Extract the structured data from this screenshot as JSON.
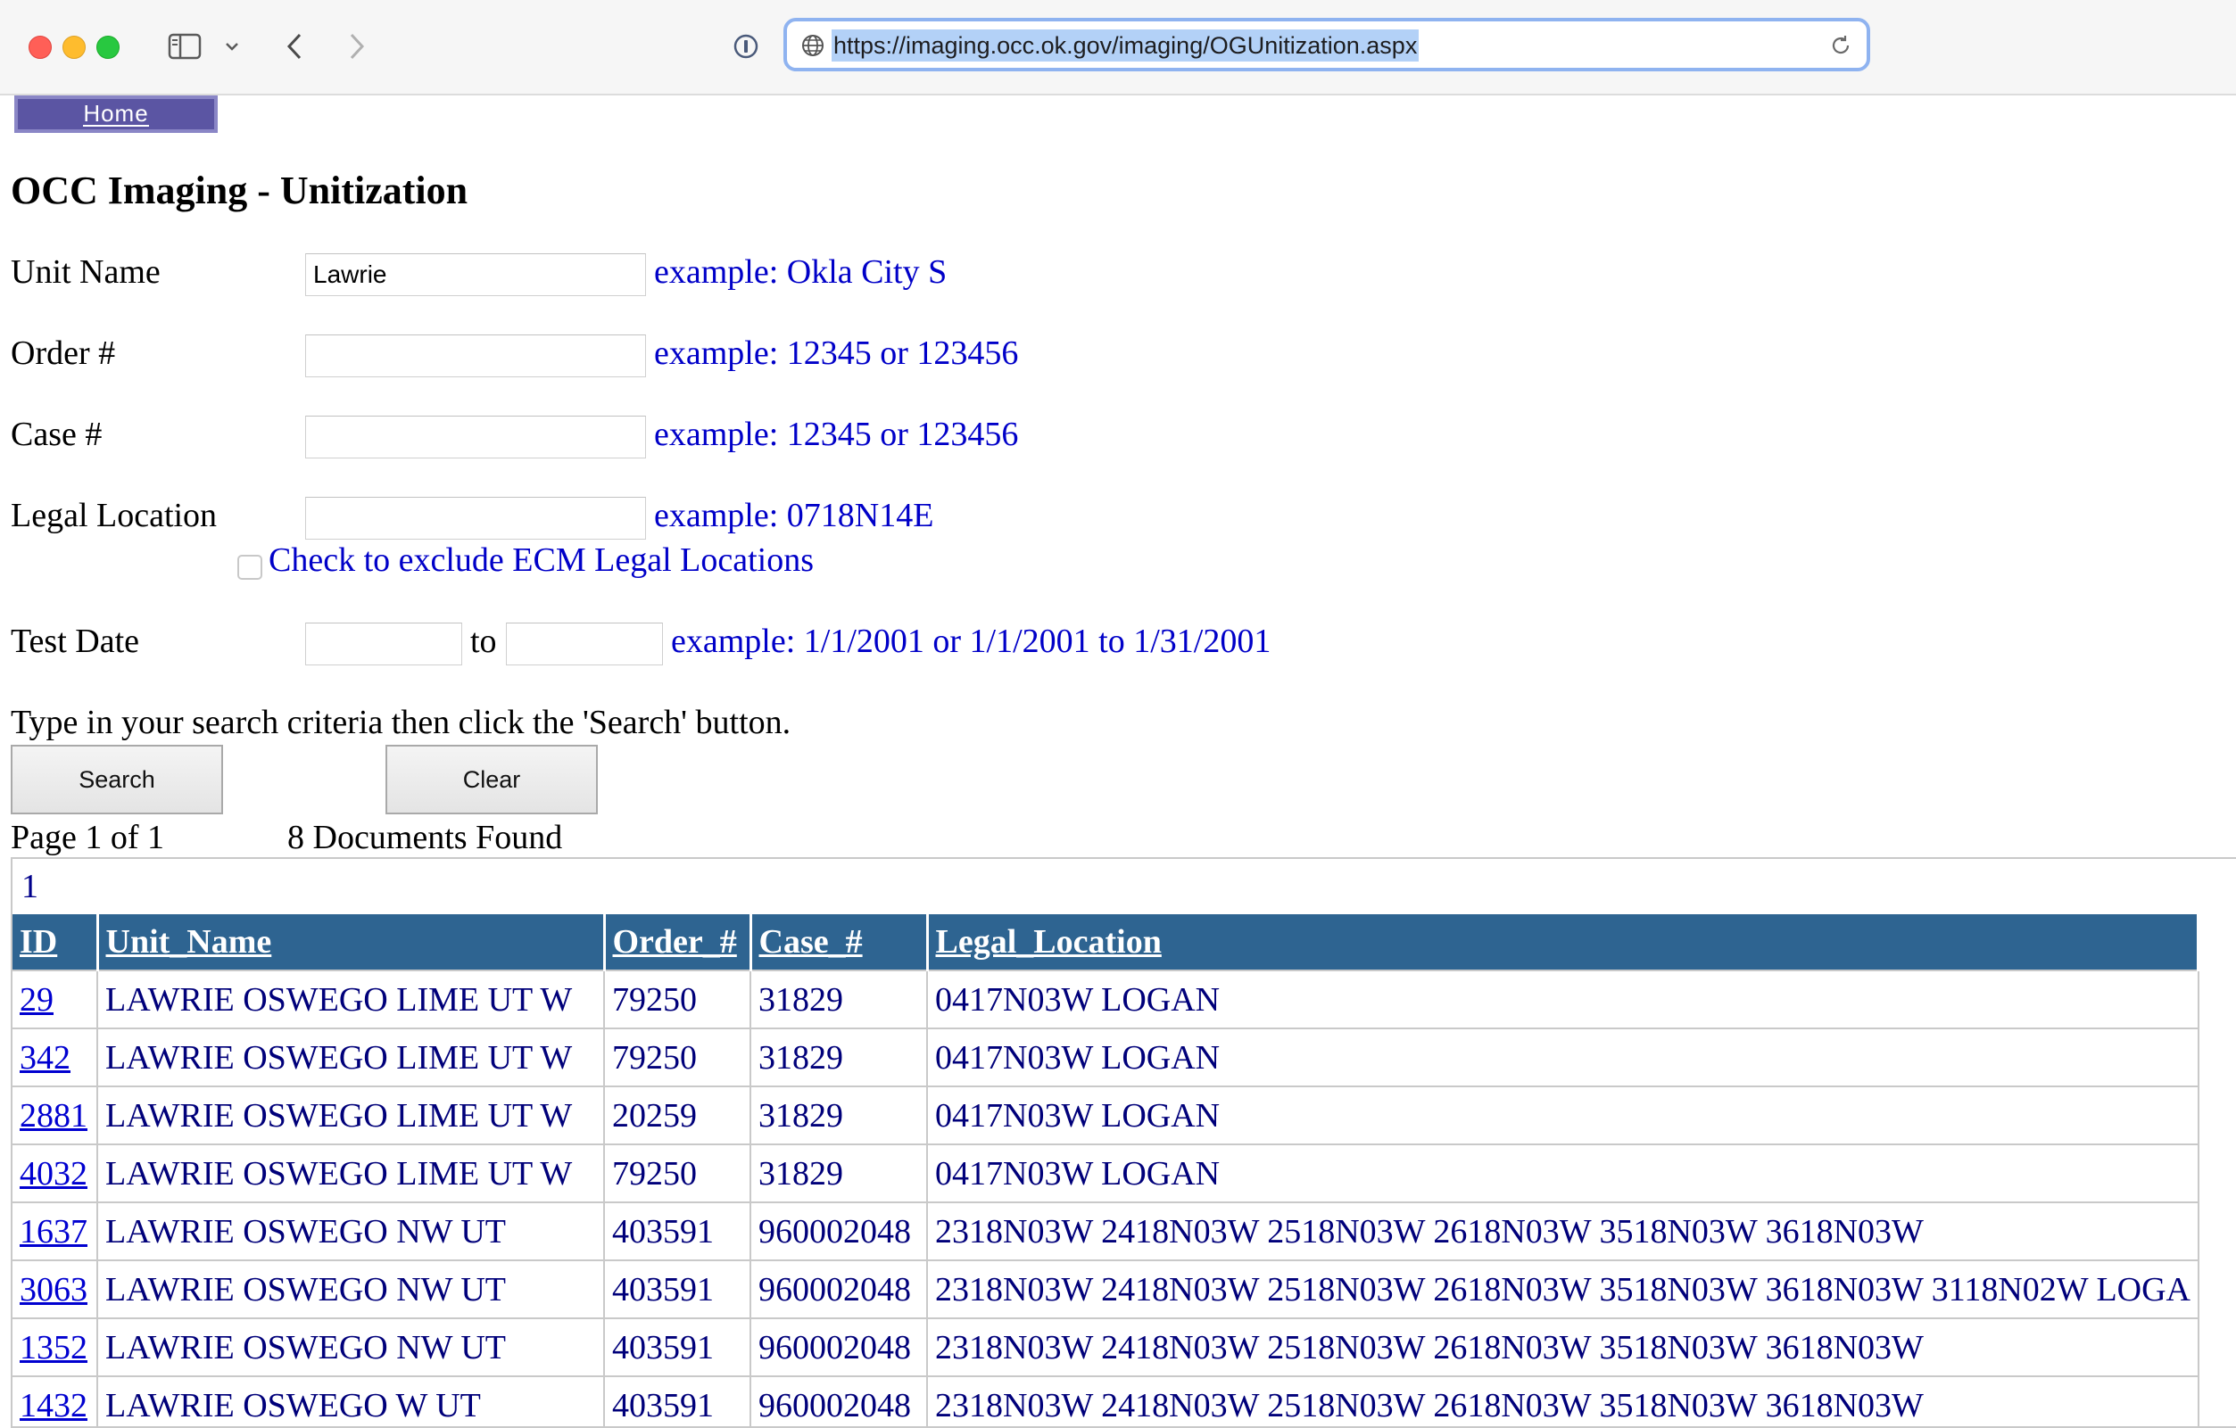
{
  "browser": {
    "url": "https://imaging.occ.ok.gov/imaging/OGUnitization.aspx"
  },
  "page": {
    "home_label": "Home",
    "title": "OCC Imaging - Unitization",
    "form": {
      "unit_name": {
        "label": "Unit Name",
        "value": "Lawrie",
        "example": "example: Okla City S"
      },
      "order": {
        "label": "Order #",
        "value": "",
        "example": "example: 12345 or 123456"
      },
      "case": {
        "label": "Case #",
        "value": "",
        "example": "example: 12345 or 123456"
      },
      "legal_location": {
        "label": "Legal Location",
        "value": "",
        "example": "example: 0718N14E"
      },
      "exclude_ecm_label": "Check to exclude ECM Legal Locations",
      "test_date": {
        "label": "Test Date",
        "from_value": "",
        "to_label": "to",
        "to_value": "",
        "example": "example: 1/1/2001 or 1/1/2001 to 1/31/2001"
      }
    },
    "instructions": "Type in your search criteria then click the 'Search' button.",
    "search_label": "Search",
    "clear_label": "Clear",
    "page_info": "Page 1 of 1",
    "documents_found": "8 Documents Found"
  },
  "results": {
    "pager": "1",
    "columns": [
      "ID",
      "Unit_Name",
      "Order_#",
      "Case_#",
      "Legal_Location"
    ],
    "rows": [
      [
        "29",
        "LAWRIE OSWEGO LIME UT W",
        "79250",
        "31829",
        "0417N03W LOGAN"
      ],
      [
        "342",
        "LAWRIE OSWEGO LIME UT W",
        "79250",
        "31829",
        "0417N03W LOGAN"
      ],
      [
        "2881",
        "LAWRIE OSWEGO LIME UT W",
        "20259",
        "31829",
        "0417N03W LOGAN"
      ],
      [
        "4032",
        "LAWRIE OSWEGO LIME UT W",
        "79250",
        "31829",
        "0417N03W LOGAN"
      ],
      [
        "1637",
        "LAWRIE OSWEGO NW UT",
        "403591",
        "960002048",
        "2318N03W 2418N03W 2518N03W 2618N03W 3518N03W 3618N03W"
      ],
      [
        "3063",
        "LAWRIE OSWEGO NW UT",
        "403591",
        "960002048",
        "2318N03W 2418N03W 2518N03W 2618N03W 3518N03W 3618N03W 3118N02W LOGA"
      ],
      [
        "1352",
        "LAWRIE OSWEGO NW UT",
        "403591",
        "960002048",
        "2318N03W 2418N03W 2518N03W 2618N03W 3518N03W 3618N03W"
      ],
      [
        "1432",
        "LAWRIE OSWEGO W UT",
        "403591",
        "960002048",
        "2318N03W 2418N03W 2518N03W 2618N03W 3518N03W 3618N03W"
      ]
    ]
  }
}
